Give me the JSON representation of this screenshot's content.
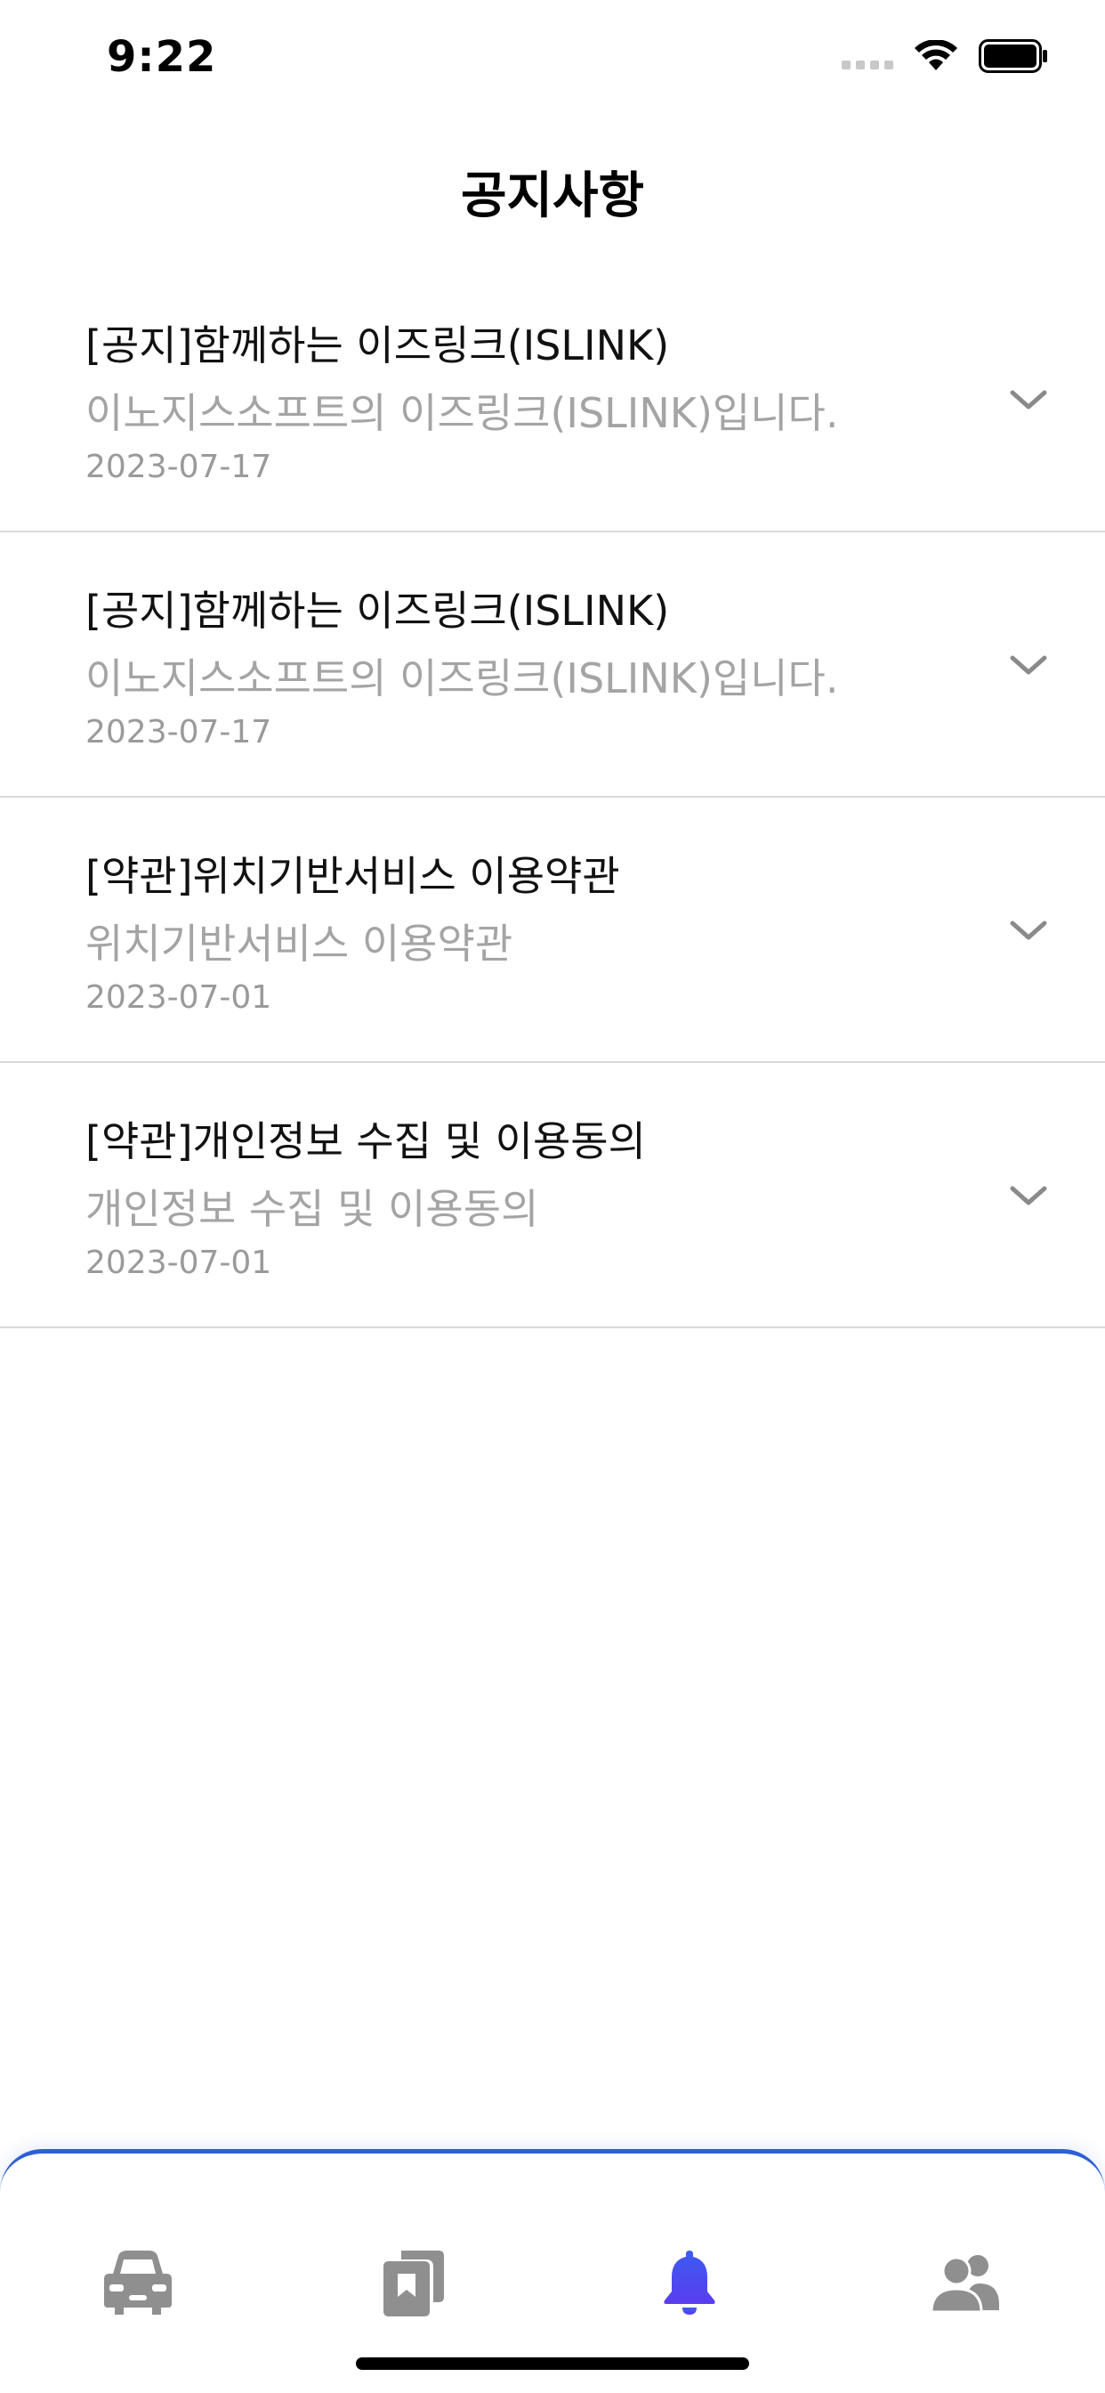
{
  "status_bar": {
    "time": "9:22"
  },
  "header": {
    "title": "공지사항"
  },
  "notices": [
    {
      "title": "[공지]함께하는 이즈링크(ISLINK)",
      "summary": "이노지스소프트의 이즈링크(ISLINK)입니다.",
      "date": "2023-07-17"
    },
    {
      "title": "[공지]함께하는 이즈링크(ISLINK)",
      "summary": "이노지스소프트의 이즈링크(ISLINK)입니다.",
      "date": "2023-07-17"
    },
    {
      "title": "[약관]위치기반서비스 이용약관",
      "summary": "위치기반서비스 이용약관",
      "date": "2023-07-01"
    },
    {
      "title": "[약관]개인정보 수집 및 이용동의",
      "summary": "개인정보 수집 및 이용동의",
      "date": "2023-07-01"
    }
  ],
  "tab_bar": {
    "tabs": [
      {
        "icon": "car-icon",
        "active": false
      },
      {
        "icon": "bookmark-book-icon",
        "active": false
      },
      {
        "icon": "bell-icon",
        "active": true
      },
      {
        "icon": "users-icon",
        "active": false
      }
    ]
  },
  "colors": {
    "accent": "#2e5fd6",
    "active_tab": "#3b5bf0",
    "inactive_tab": "#8f8f8f",
    "muted_text": "#a4a4a4",
    "divider": "#d9d9d9"
  }
}
